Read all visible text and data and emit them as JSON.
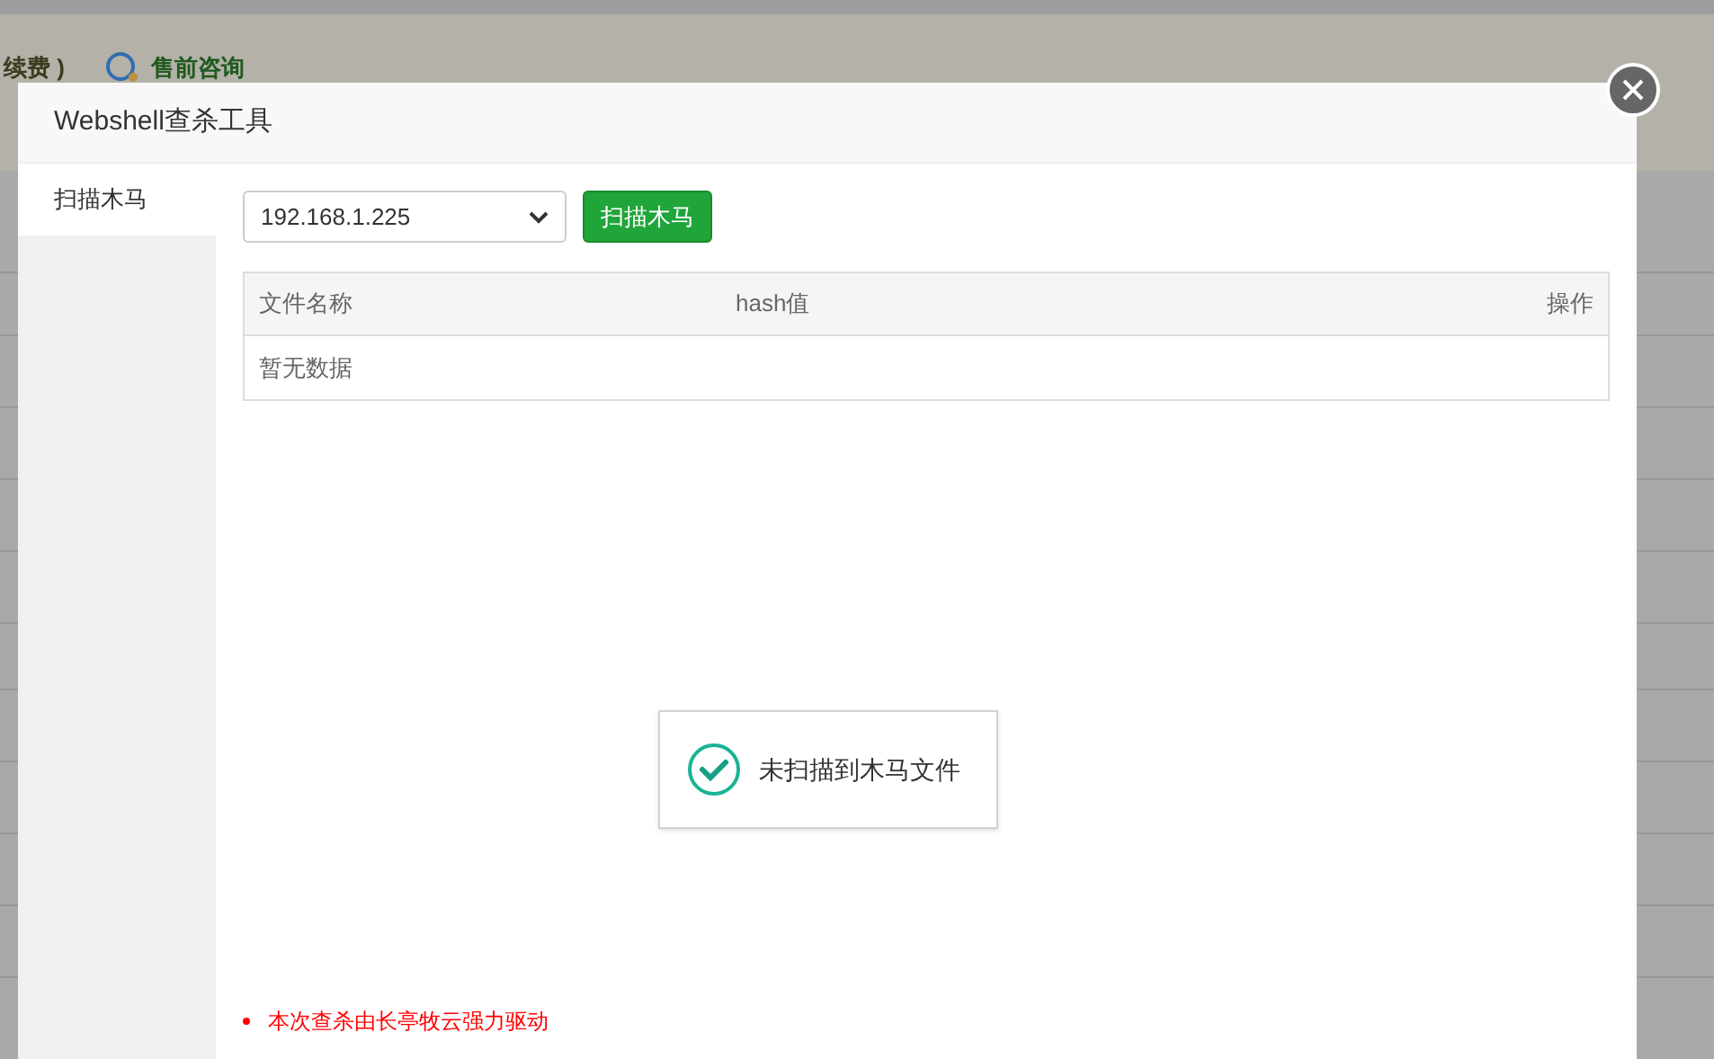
{
  "background": {
    "header_items": [
      {
        "label": "续费 )",
        "kind": "text"
      },
      {
        "label": "售前咨询",
        "kind": "link"
      }
    ]
  },
  "dialog": {
    "title": "Webshell查杀工具",
    "sidebar": {
      "items": [
        {
          "label": "扫描木马",
          "selected": true
        }
      ]
    },
    "server_select": {
      "value": "192.168.1.225"
    },
    "scan_button": "扫描木马",
    "table": {
      "columns": [
        "文件名称",
        "hash值",
        "操作"
      ],
      "empty_text": "暂无数据"
    },
    "toast": {
      "message": "未扫描到木马文件"
    },
    "notes": [
      "本次查杀由长亭牧云强力驱动"
    ]
  }
}
